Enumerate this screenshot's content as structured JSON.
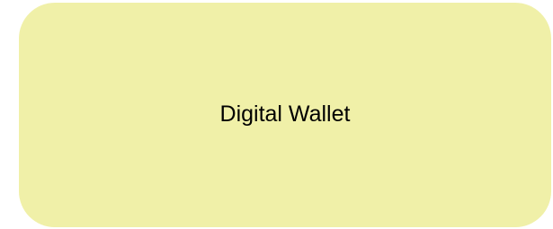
{
  "node": {
    "label": "Digital Wallet",
    "fill_color": "#f0f0a8"
  }
}
